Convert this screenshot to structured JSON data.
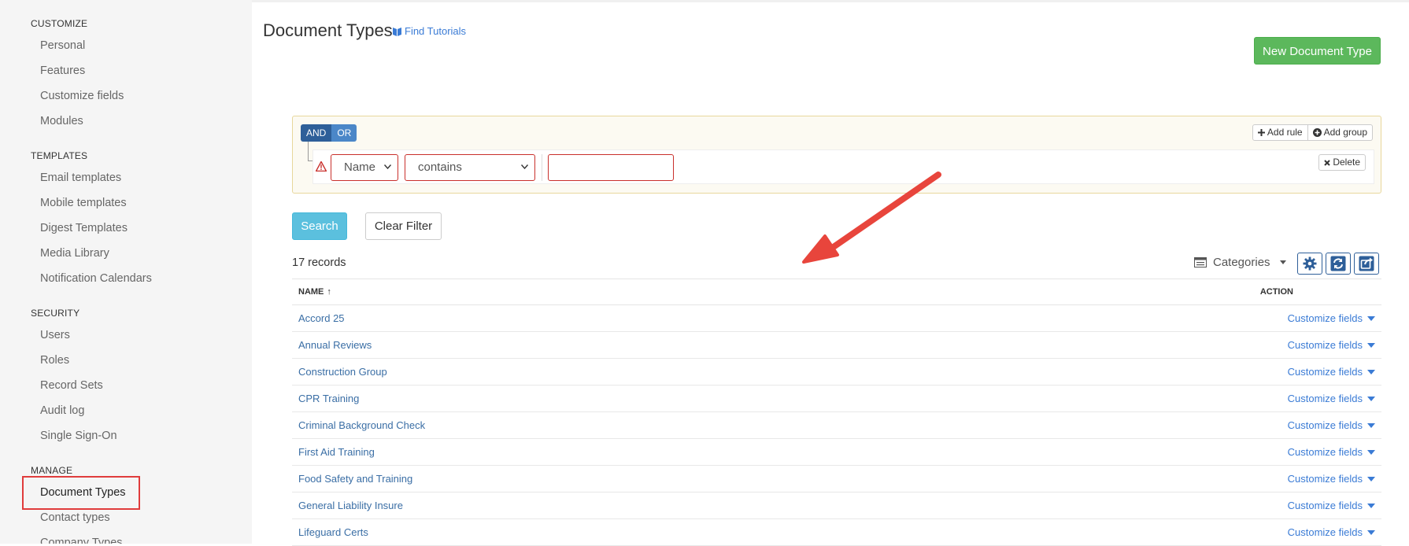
{
  "sidebar": {
    "sections": [
      {
        "heading": "CUSTOMIZE",
        "items": [
          "Personal",
          "Features",
          "Customize fields",
          "Modules"
        ]
      },
      {
        "heading": "TEMPLATES",
        "items": [
          "Email templates",
          "Mobile templates",
          "Digest Templates",
          "Media Library",
          "Notification Calendars"
        ]
      },
      {
        "heading": "SECURITY",
        "items": [
          "Users",
          "Roles",
          "Record Sets",
          "Audit log",
          "Single Sign-On"
        ]
      },
      {
        "heading": "MANAGE",
        "items": [
          "Document Types",
          "Contact types",
          "Company Types"
        ]
      }
    ]
  },
  "header": {
    "title": "Document Types",
    "tutorials": "Find Tutorials",
    "new_button": "New Document Type"
  },
  "filter": {
    "and_label": "AND",
    "or_label": "OR",
    "add_rule": "Add rule",
    "add_group": "Add group",
    "delete": "Delete",
    "field": "Name",
    "operator": "contains",
    "value": ""
  },
  "actions": {
    "search": "Search",
    "clear": "Clear Filter"
  },
  "records_label": "17 records",
  "categories_label": "Categories",
  "table": {
    "col_name": "NAME",
    "sort_indicator": "↑",
    "col_action": "ACTION",
    "action_label": "Customize fields",
    "rows": [
      "Accord 25",
      "Annual Reviews",
      "Construction Group",
      "CPR Training",
      "Criminal Background Check",
      "First Aid Training",
      "Food Safety and Training",
      "General Liability Insure",
      "Lifeguard Certs"
    ]
  },
  "colors": {
    "sidebar_bg": "#f5f5f5",
    "new_button": "#5cb85c",
    "search_button": "#5bc0de",
    "link": "#3a7bd5",
    "annotation": "#e03c3c"
  }
}
